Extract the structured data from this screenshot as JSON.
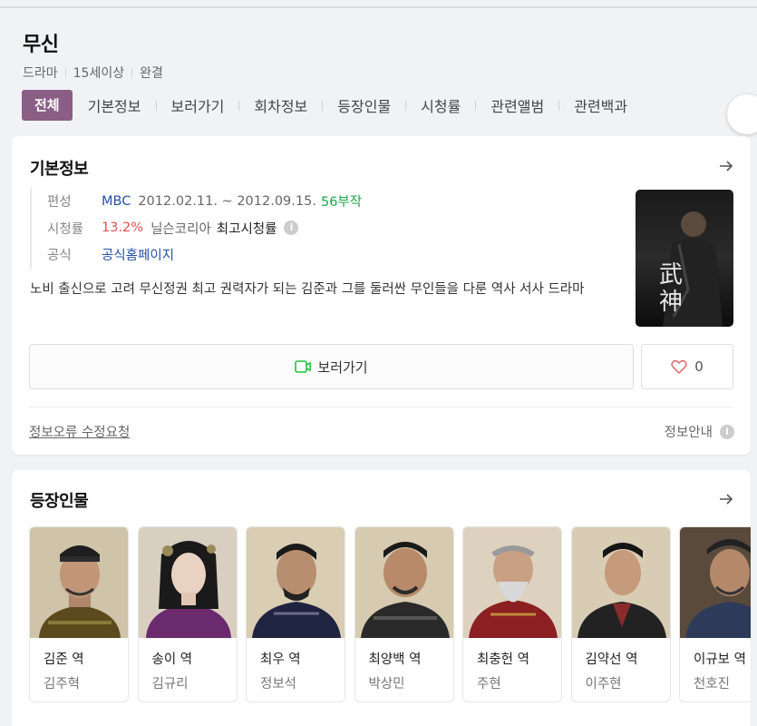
{
  "header": {
    "title": "무신",
    "meta": [
      "드라마",
      "15세이상",
      "완결"
    ]
  },
  "tabs": [
    {
      "label": "전체",
      "active": true
    },
    {
      "label": "기본정보"
    },
    {
      "label": "보러가기"
    },
    {
      "label": "회차정보"
    },
    {
      "label": "등장인물"
    },
    {
      "label": "시청률"
    },
    {
      "label": "관련앨범"
    },
    {
      "label": "관련백과"
    }
  ],
  "basic_info": {
    "title": "기본정보",
    "broadcast": {
      "key": "편성",
      "channel": "MBC",
      "period": "2012.02.11. ~ 2012.09.15.",
      "episodes": "56부작"
    },
    "rating": {
      "key": "시청률",
      "value": "13.2%",
      "source": "닐슨코리아",
      "label": "최고시청률"
    },
    "official": {
      "key": "공식",
      "link": "공식홈페이지"
    },
    "description": "노비 출신으로 고려 무신정권 최고 권력자가 되는 김준과 그를 둘러싼 무인들을 다룬 역사 서사 드라마",
    "poster_text": "武神",
    "watch_label": "보러가기",
    "like_count": "0",
    "report_label": "정보오류 수정요청",
    "guide_label": "정보안내"
  },
  "cast_section": {
    "title": "등장인물",
    "items": [
      {
        "role": "김준 역",
        "actor": "김주혁"
      },
      {
        "role": "송이 역",
        "actor": "김규리"
      },
      {
        "role": "최우 역",
        "actor": "정보석"
      },
      {
        "role": "최양백 역",
        "actor": "박상민"
      },
      {
        "role": "최충헌 역",
        "actor": "주현"
      },
      {
        "role": "김약선 역",
        "actor": "이주현"
      },
      {
        "role": "이규보 역",
        "actor": "천호진"
      }
    ]
  },
  "colors": {
    "active_tab": "#8b5e86",
    "link": "#2550a8",
    "rating": "#e05050",
    "episodes": "#1ba745"
  }
}
